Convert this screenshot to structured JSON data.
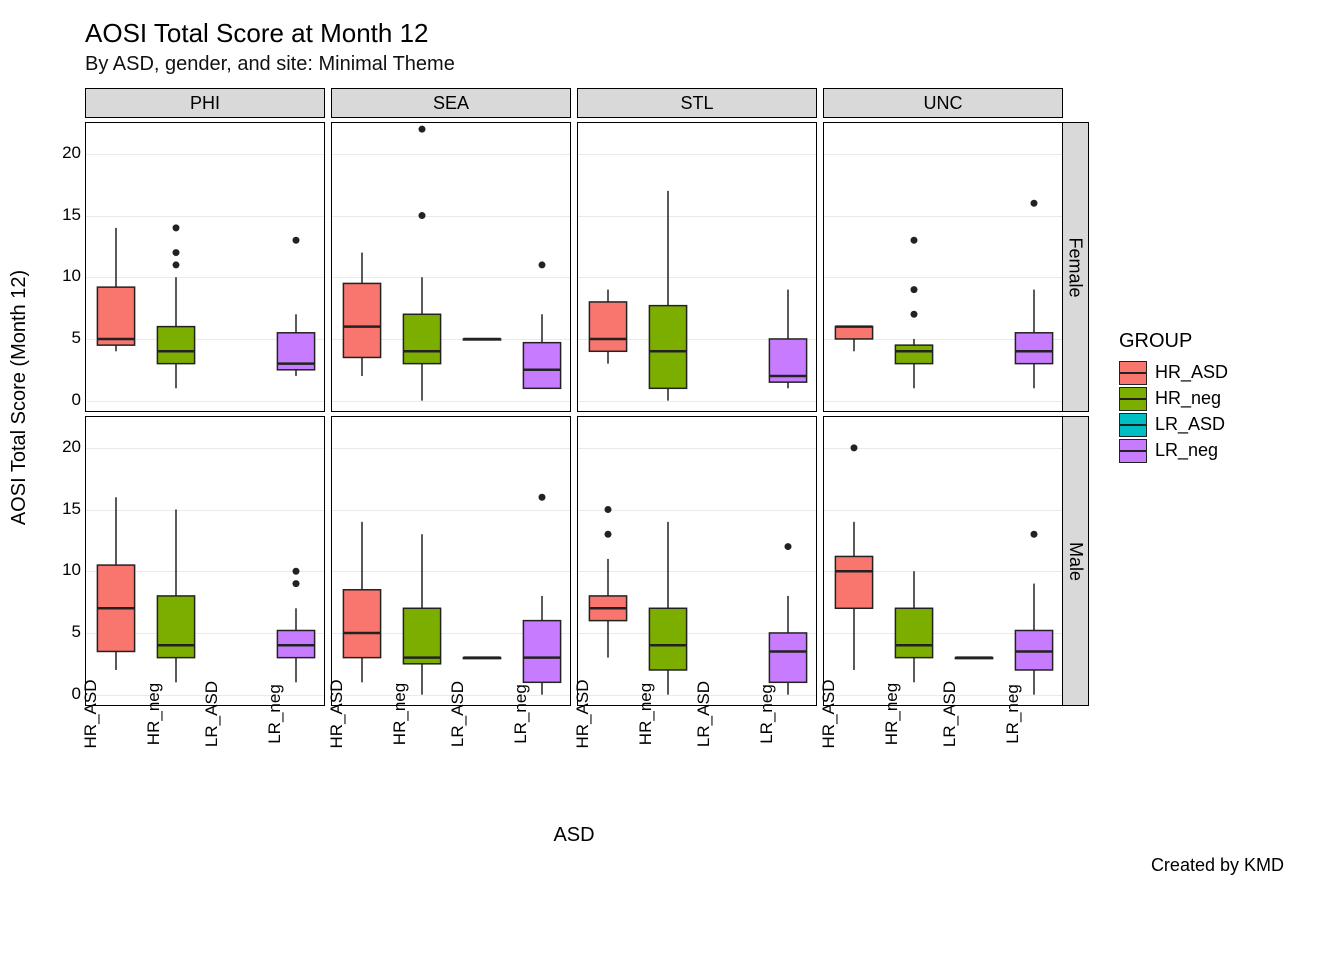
{
  "title": "AOSI Total Score at Month 12",
  "subtitle": "By ASD, gender, and site: Minimal Theme",
  "ylabel": "AOSI Total Score (Month 12)",
  "xlabel": "ASD",
  "caption": "Created by KMD",
  "legend": {
    "title": "GROUP",
    "items": [
      {
        "name": "HR_ASD",
        "color": "#F8766D"
      },
      {
        "name": "HR_neg",
        "color": "#7CAE00"
      },
      {
        "name": "LR_ASD",
        "color": "#00BFC4"
      },
      {
        "name": "LR_neg",
        "color": "#C77CFF"
      }
    ]
  },
  "chart_data": {
    "type": "boxplot-facet-grid",
    "x_categories": [
      "HR_ASD",
      "HR_neg",
      "LR_ASD",
      "LR_neg"
    ],
    "y_ticks": [
      0,
      5,
      10,
      15,
      20
    ],
    "ylim": [
      -1,
      22.5
    ],
    "facet_cols": [
      "PHI",
      "SEA",
      "STL",
      "UNC"
    ],
    "facet_rows": [
      "Female",
      "Male"
    ],
    "group_colors": {
      "HR_ASD": "#F8766D",
      "HR_neg": "#7CAE00",
      "LR_ASD": "#00BFC4",
      "LR_neg": "#C77CFF"
    },
    "boxes": {
      "Female": {
        "PHI": {
          "HR_ASD": {
            "min": 4,
            "q1": 4.5,
            "med": 5,
            "q3": 9.2,
            "max": 14,
            "out": []
          },
          "HR_neg": {
            "min": 1,
            "q1": 3,
            "med": 4,
            "q3": 6,
            "max": 10,
            "out": [
              11,
              12,
              14
            ]
          },
          "LR_ASD": null,
          "LR_neg": {
            "min": 2,
            "q1": 2.5,
            "med": 3,
            "q3": 5.5,
            "max": 7,
            "out": [
              13
            ]
          }
        },
        "SEA": {
          "HR_ASD": {
            "min": 2,
            "q1": 3.5,
            "med": 6,
            "q3": 9.5,
            "max": 12,
            "out": []
          },
          "HR_neg": {
            "min": 0,
            "q1": 3,
            "med": 4,
            "q3": 7,
            "max": 10,
            "out": [
              15,
              22
            ]
          },
          "LR_ASD": {
            "min": 5,
            "q1": 5,
            "med": 5,
            "q3": 5,
            "max": 5,
            "out": []
          },
          "LR_neg": {
            "min": 1,
            "q1": 1,
            "med": 2.5,
            "q3": 4.7,
            "max": 7,
            "out": [
              11
            ]
          }
        },
        "STL": {
          "HR_ASD": {
            "min": 3,
            "q1": 4,
            "med": 5,
            "q3": 8,
            "max": 9,
            "out": []
          },
          "HR_neg": {
            "min": 0,
            "q1": 1,
            "med": 4,
            "q3": 7.7,
            "max": 17,
            "out": []
          },
          "LR_ASD": null,
          "LR_neg": {
            "min": 1,
            "q1": 1.5,
            "med": 2,
            "q3": 5,
            "max": 9,
            "out": []
          }
        },
        "UNC": {
          "HR_ASD": {
            "min": 4,
            "q1": 5,
            "med": 6,
            "q3": 6,
            "max": 6,
            "out": []
          },
          "HR_neg": {
            "min": 1,
            "q1": 3,
            "med": 4,
            "q3": 4.5,
            "max": 5,
            "out": [
              7,
              9,
              13
            ]
          },
          "LR_ASD": null,
          "LR_neg": {
            "min": 1,
            "q1": 3,
            "med": 4,
            "q3": 5.5,
            "max": 9,
            "out": [
              16
            ]
          }
        }
      },
      "Male": {
        "PHI": {
          "HR_ASD": {
            "min": 2,
            "q1": 3.5,
            "med": 7,
            "q3": 10.5,
            "max": 16,
            "out": []
          },
          "HR_neg": {
            "min": 1,
            "q1": 3,
            "med": 4,
            "q3": 8,
            "max": 15,
            "out": []
          },
          "LR_ASD": null,
          "LR_neg": {
            "min": 1,
            "q1": 3,
            "med": 4,
            "q3": 5.2,
            "max": 7,
            "out": [
              9,
              10
            ]
          }
        },
        "SEA": {
          "HR_ASD": {
            "min": 1,
            "q1": 3,
            "med": 5,
            "q3": 8.5,
            "max": 14,
            "out": []
          },
          "HR_neg": {
            "min": 0,
            "q1": 2.5,
            "med": 3,
            "q3": 7,
            "max": 13,
            "out": []
          },
          "LR_ASD": {
            "min": 3,
            "q1": 3,
            "med": 3,
            "q3": 3,
            "max": 3,
            "out": []
          },
          "LR_neg": {
            "min": 0,
            "q1": 1,
            "med": 3,
            "q3": 6,
            "max": 8,
            "out": [
              16
            ]
          }
        },
        "STL": {
          "HR_ASD": {
            "min": 3,
            "q1": 6,
            "med": 7,
            "q3": 8,
            "max": 11,
            "out": [
              13,
              15
            ]
          },
          "HR_neg": {
            "min": 0,
            "q1": 2,
            "med": 4,
            "q3": 7,
            "max": 14,
            "out": []
          },
          "LR_ASD": null,
          "LR_neg": {
            "min": 0,
            "q1": 1,
            "med": 3.5,
            "q3": 5,
            "max": 8,
            "out": [
              12
            ]
          }
        },
        "UNC": {
          "HR_ASD": {
            "min": 2,
            "q1": 7,
            "med": 10,
            "q3": 11.2,
            "max": 14,
            "out": [
              20
            ]
          },
          "HR_neg": {
            "min": 1,
            "q1": 3,
            "med": 4,
            "q3": 7,
            "max": 10,
            "out": []
          },
          "LR_ASD": {
            "min": 3,
            "q1": 3,
            "med": 3,
            "q3": 3,
            "max": 3,
            "out": []
          },
          "LR_neg": {
            "min": 0,
            "q1": 2,
            "med": 3.5,
            "q3": 5.2,
            "max": 9,
            "out": [
              13
            ]
          }
        }
      }
    }
  }
}
